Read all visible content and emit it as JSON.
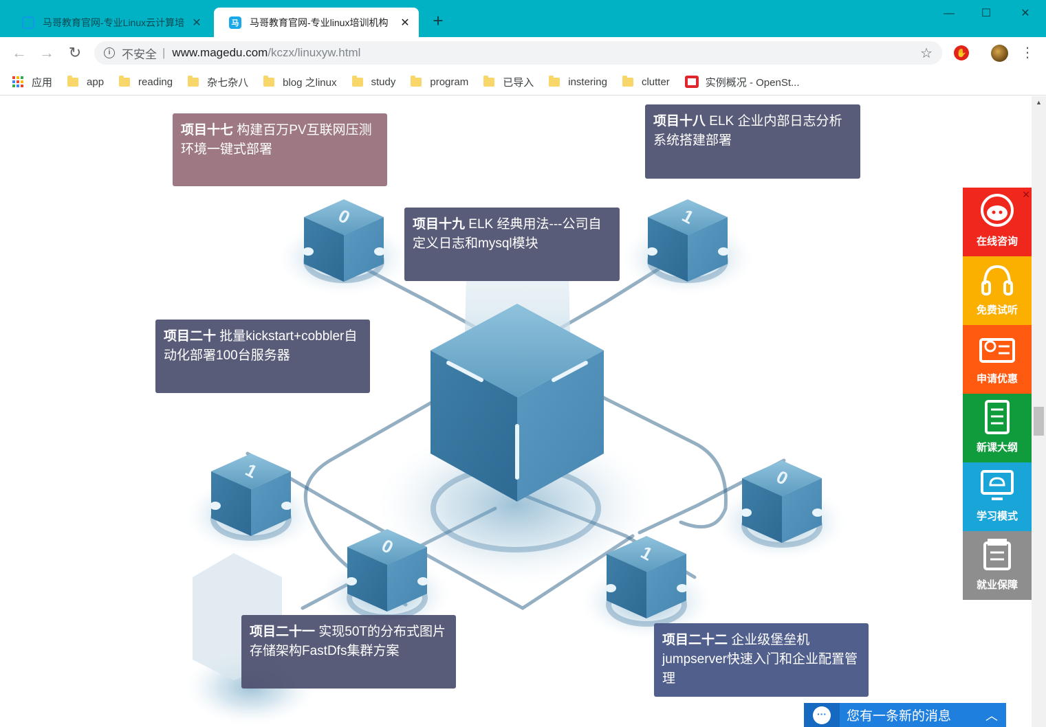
{
  "browser": {
    "tabs": [
      {
        "title": "马哥教育官网-专业Linux云计算培",
        "active": false
      },
      {
        "title": "马哥教育官网-专业linux培训机构",
        "active": true
      }
    ],
    "new_tab_label": "+",
    "window_controls": {
      "minimize": "—",
      "maximize": "☐",
      "close": "✕"
    },
    "address": {
      "security_label": "不安全",
      "separator": "|",
      "host": "www.magedu.com",
      "path": "/kczx/linuxyw.html"
    },
    "bookmarks": [
      {
        "label": "应用",
        "icon": "apps-icon"
      },
      {
        "label": "app",
        "icon": "folder-icon"
      },
      {
        "label": "reading",
        "icon": "folder-icon"
      },
      {
        "label": "杂七杂八",
        "icon": "folder-icon"
      },
      {
        "label": "blog 之linux",
        "icon": "folder-icon"
      },
      {
        "label": "study",
        "icon": "folder-icon"
      },
      {
        "label": "program",
        "icon": "folder-icon"
      },
      {
        "label": "已导入",
        "icon": "folder-icon"
      },
      {
        "label": "instering",
        "icon": "folder-icon"
      },
      {
        "label": "clutter",
        "icon": "folder-icon"
      },
      {
        "label": "实例概况 - OpenSt...",
        "icon": "openstack-icon"
      }
    ]
  },
  "projects": [
    {
      "id": "p17",
      "num": "项目十七",
      "text": "构建百万PV互联网压测环境一键式部署"
    },
    {
      "id": "p18",
      "num": "项目十八",
      "text": "ELK 企业内部日志分析系统搭建部署"
    },
    {
      "id": "p19",
      "num": "项目十九",
      "text": "ELK 经典用法---公司自定义日志和mysql模块"
    },
    {
      "id": "p20",
      "num": "项目二十",
      "text": "批量kickstart+cobbler自动化部署100台服务器"
    },
    {
      "id": "p21",
      "num": "项目二十一",
      "text": "实现50T的分布式图片存储架构FastDfs集群方案"
    },
    {
      "id": "p22",
      "num": "项目二十二",
      "text": "企业级堡垒机jumpserver快速入门和企业配置管理"
    }
  ],
  "cube_labels": [
    "0",
    "1",
    "1",
    "0",
    "0",
    "1"
  ],
  "side_panel": [
    {
      "label": "在线咨询",
      "color": "#f0271c",
      "icon": "headset-avatar-icon"
    },
    {
      "label": "免费试听",
      "color": "#fbb000",
      "icon": "headphones-icon"
    },
    {
      "label": "申请优惠",
      "color": "#ff5a10",
      "icon": "coupon-icon"
    },
    {
      "label": "新课大纲",
      "color": "#109b3c",
      "icon": "document-icon"
    },
    {
      "label": "学习模式",
      "color": "#1aa5d8",
      "icon": "network-monitor-icon"
    },
    {
      "label": "就业保障",
      "color": "#8e8e8e",
      "icon": "offer-icon"
    }
  ],
  "side_close": "✕",
  "chat": {
    "text": "您有一条新的消息",
    "icon": "chat-bubble-icon"
  }
}
